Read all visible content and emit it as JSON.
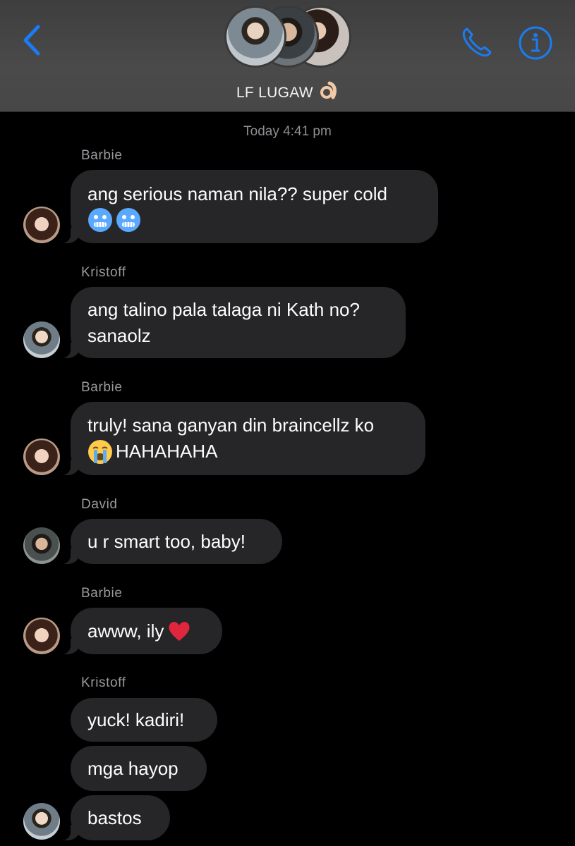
{
  "header": {
    "title": "LF LUGAW",
    "title_emoji": "👌",
    "back_icon": "chevron-left-icon",
    "call_icon": "phone-icon",
    "info_icon": "info-icon",
    "accent_color": "#1a7cf3"
  },
  "chat": {
    "timestamp": "Today 4:41 pm",
    "senders": {
      "barbie": "Barbie",
      "kristoff": "Kristoff",
      "david": "David"
    },
    "messages": {
      "m1": {
        "text": "ang serious naman nila?? super cold",
        "emoji": "cold-face-emoji"
      },
      "m2": {
        "line1": "ang talino pala talaga ni Kath no?",
        "line2": "sanaolz"
      },
      "m3": {
        "line1": "truly! sana ganyan din braincellz ko",
        "line2": "HAHAHAHA",
        "emoji": "loudly-crying-face-emoji"
      },
      "m4": {
        "text": "u r smart too, baby!"
      },
      "m5": {
        "text": "awww, ily",
        "emoji": "red-heart-emoji"
      },
      "m6": {
        "text": "yuck! kadiri!"
      },
      "m7": {
        "text": "mga hayop"
      },
      "m8": {
        "text": "bastos"
      }
    }
  }
}
